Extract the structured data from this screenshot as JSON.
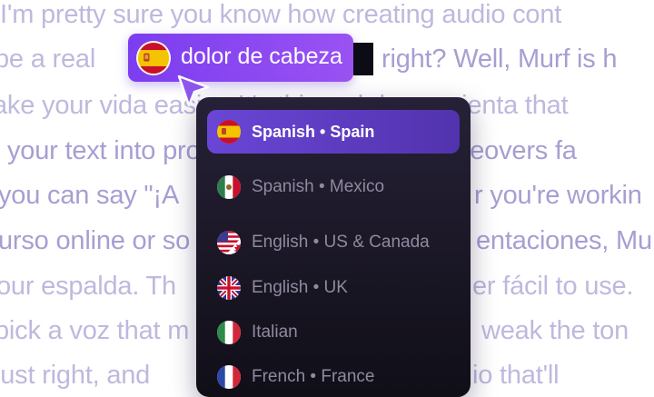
{
  "background_lines": [
    "I'm pretty sure you know how creating audio cont",
    "be a real",
    "right? Well, Murf is h",
    "ake your vida easier. It's this web herramienta that",
    "your text into professional-sounding voiceovers fa",
    "you can say \"¡A",
    "r you're workin",
    "urso online or so",
    "entaciones, Mu",
    "our espalda. Th",
    "er fácil to use.",
    "pick a voz that m",
    "weak the ton",
    "just right, and",
    "io that'll"
  ],
  "highlight": {
    "phrase": "dolor de cabeza",
    "flag_icon": "spain-flag-icon"
  },
  "colors": {
    "accent_gradient_start": "#7b3df0",
    "accent_gradient_end": "#9a52f2",
    "panel_bg": "#1b1727",
    "selected_item_bg": "#5f3ec7"
  },
  "language_menu": {
    "items": [
      {
        "label": "Spanish • Spain",
        "flag": "spain-flag-icon",
        "selected": true
      },
      {
        "label": "Spanish • Mexico",
        "flag": "mexico-flag-icon",
        "selected": false
      },
      {
        "label": "English • US & Canada",
        "flag": "us-canada-flag-icon",
        "selected": false
      },
      {
        "label": "English • UK",
        "flag": "uk-flag-icon",
        "selected": false
      },
      {
        "label": "Italian",
        "flag": "italy-flag-icon",
        "selected": false
      },
      {
        "label": "French • France",
        "flag": "france-flag-icon",
        "selected": false
      }
    ]
  }
}
